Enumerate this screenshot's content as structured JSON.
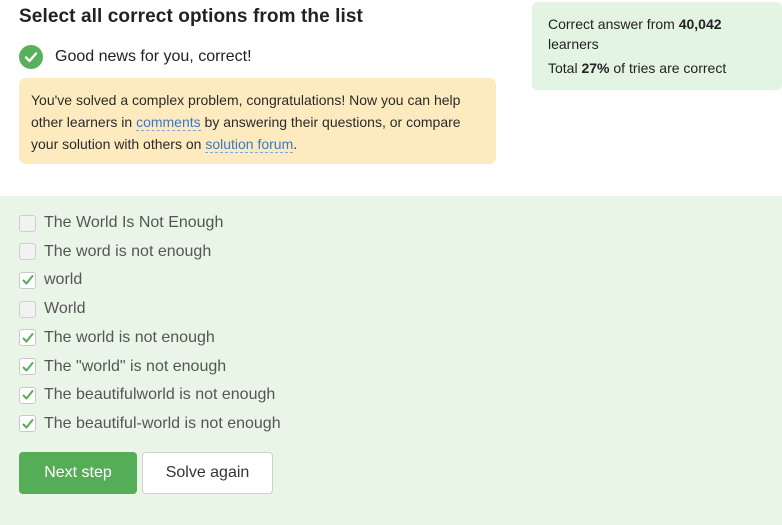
{
  "title": "Select all correct options from the list",
  "status": {
    "icon": "check-circle-icon",
    "text": "Good news for you, correct!"
  },
  "notice": {
    "part1": "You've solved a complex problem, congratulations! Now you can help other learners in ",
    "comments_link": "comments",
    "part2": " by answering their questions, or compare your solution with others on ",
    "forum_link": "solution forum",
    "part3": "."
  },
  "stats": {
    "prefix": "Correct answer from ",
    "learners_count": "40,042",
    "learners_suffix": " learners",
    "total_prefix": "Total ",
    "percent": "27%",
    "total_suffix": " of tries are correct"
  },
  "options": [
    {
      "label": "The World Is Not Enough",
      "checked": false
    },
    {
      "label": "The word is not enough",
      "checked": false
    },
    {
      "label": "world",
      "checked": true
    },
    {
      "label": "World",
      "checked": false
    },
    {
      "label": "The world is not enough",
      "checked": true
    },
    {
      "label": "The \"world\" is not enough",
      "checked": true
    },
    {
      "label": "The beautifulworld is not enough",
      "checked": true
    },
    {
      "label": "The beautiful-world is not enough",
      "checked": true
    }
  ],
  "buttons": {
    "next": "Next step",
    "again": "Solve again"
  },
  "colors": {
    "accent": "#55ad58",
    "success_bg": "#e9f6e7",
    "notice_bg": "#fdebbf",
    "link": "#3a77c9"
  }
}
